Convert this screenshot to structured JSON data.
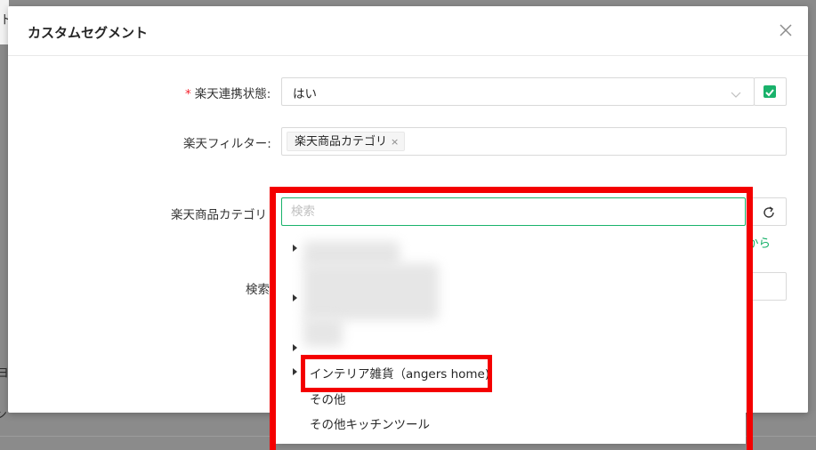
{
  "background": {
    "edge_fragments": [
      "ト",
      "ヨ",
      "ン"
    ]
  },
  "dialog": {
    "title": "カスタムセグメント",
    "fields": {
      "rakuten_link": {
        "label": "楽天連携状態:",
        "required_mark": "*",
        "value": "はい"
      },
      "rakuten_filter": {
        "label": "楽天フィルター:",
        "tag": "楽天商品カテゴリ",
        "tag_close": "×"
      },
      "rakuten_category": {
        "label": "楽天商品カテゴリ",
        "link_text": "から"
      },
      "search": {
        "label": "検索"
      }
    }
  },
  "dropdown": {
    "search_placeholder": "検索",
    "items": [
      {
        "label": "インテリア雑貨（angers home)",
        "has_children": true
      },
      {
        "label": "その他",
        "has_children": false
      },
      {
        "label": "その他キッチンツール",
        "has_children": false
      }
    ]
  },
  "colors": {
    "accent_green": "#19b26b",
    "annotation_red": "#f40000",
    "required_red": "#f5222d"
  }
}
